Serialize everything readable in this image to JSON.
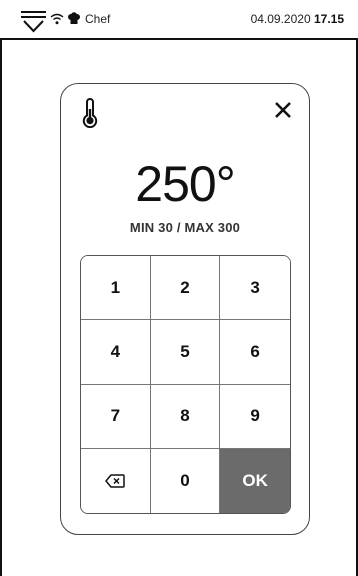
{
  "status_bar": {
    "menu_icon": "menu-down-icon",
    "wifi_icon": "wifi-icon",
    "chef_icon": "chef-hat-icon",
    "user_label": "Chef",
    "date": "04.09.2020",
    "time": "17.15"
  },
  "dialog": {
    "thermo_icon": "thermometer-icon",
    "close_icon": "close-icon",
    "value": "250°",
    "range": "MIN 30 / MAX 300"
  },
  "keypad": {
    "keys": [
      "1",
      "2",
      "3",
      "4",
      "5",
      "6",
      "7",
      "8",
      "9",
      "backspace",
      "0",
      "OK"
    ],
    "backspace_icon": "backspace-icon",
    "ok_color": "#6b6b6b"
  }
}
